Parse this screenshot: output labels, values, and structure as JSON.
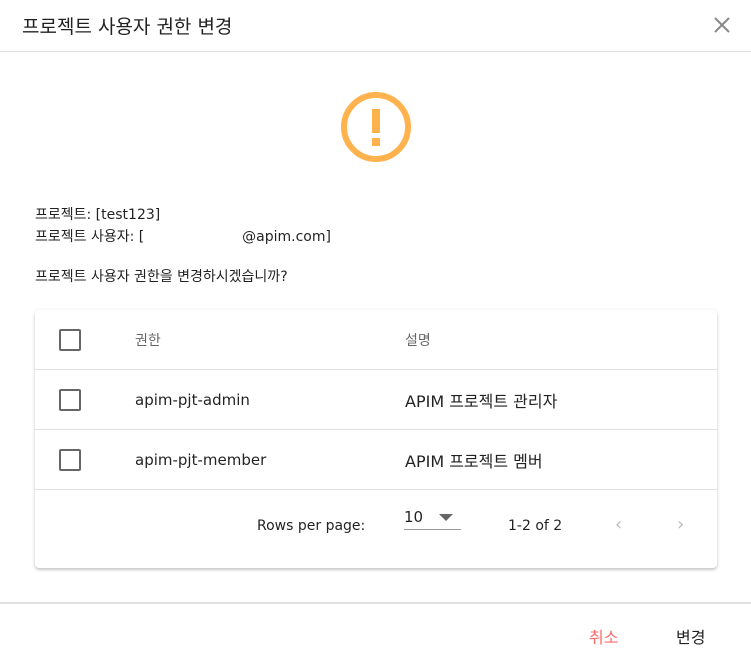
{
  "dialog": {
    "title": "프로젝트 사용자 권한 변경",
    "warning_color": "#ffb24d"
  },
  "info": {
    "project": "프로젝트: [test123]",
    "user": "프로젝트 사용자: [                      @apim.com]",
    "question": "프로젝트 사용자 권한을 변경하시겠습니까?"
  },
  "table": {
    "headers": [
      "권한",
      "설명"
    ],
    "rows": [
      {
        "role": "apim-pjt-admin",
        "desc": "APIM 프로젝트 관리자"
      },
      {
        "role": "apim-pjt-member",
        "desc": "APIM 프로젝트 멤버"
      }
    ]
  },
  "pagination": {
    "rows_per_page_label": "Rows per page:",
    "rows_per_page": "10",
    "range": "1-2 of 2"
  },
  "actions": {
    "cancel": "취소",
    "confirm": "변경",
    "cancel_color": "#ff6b6b"
  }
}
